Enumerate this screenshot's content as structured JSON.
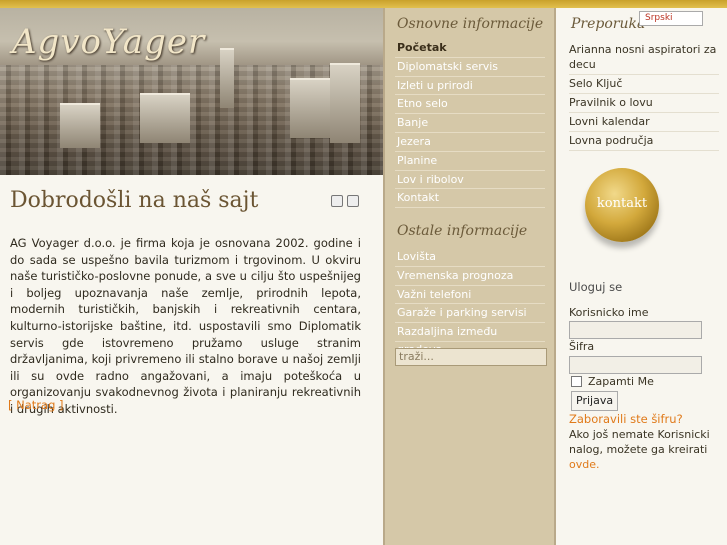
{
  "header": {
    "logo_text": "AgvoYager"
  },
  "main": {
    "title": "Dobrodošli na naš sajt",
    "intro": "AG Voyager d.o.o. je firma koja je osnovana 2002. godine i do sada se uspešno bavila turizmom i trgovinom. U okviru naše turističko-poslovne ponude, a sve u cilju što uspešnijeg i boljeg  upoznavanja naše zemlje, prirodnih lepota, modernih turističkih, banjskih i rekreativnih centara, kulturno-istorijske baštine, itd. uspostavili smo Diplomatik servis gde istovremeno pružamo usluge stranim državljanima, koji privremeno ili stalno borave u našoj zemlji ili su ovde radno angažovani, a imaju poteškoća u organizovanju svakodnevnog života i planiranju rekreativnih i drugih aktivnosti.",
    "back_link": "[ Natrag ]"
  },
  "middle": {
    "title_1": "Osnovne informacije",
    "items_1": [
      "Početak",
      "Diplomatski servis",
      "Izleti u prirodi",
      "Etno selo",
      "Banje",
      "Jezera",
      "Planine",
      "Lov i ribolov",
      "Kontakt"
    ],
    "title_2": "Ostale informacije",
    "items_2": [
      "Lovišta",
      "Vremenska prognoza",
      "Važni telefoni",
      "Garaže i parking servisi",
      "Razdaljina između gradova"
    ],
    "search_placeholder": "traži..."
  },
  "right": {
    "language": "Srpski",
    "pref_title": "Preporuka",
    "pref_items": [
      "Arianna nosni aspiratori za decu",
      "Selo Ključ",
      "Pravilnik o lovu",
      "Lovni kalendar",
      "Lovna područja"
    ],
    "seal_text": "kontakt",
    "login_title": "Uloguj se",
    "username_label": "Korisnicko ime",
    "password_label": "Šifra",
    "remember_label": "Zapamti Me",
    "login_button": "Prijava",
    "forgot_link": "Zaboravili ste šifru?",
    "register_text": "Ako još nemate Korisnicki nalog, možete ga kreirati ",
    "register_link": "ovde."
  },
  "colors": {
    "accent_gold": "#c9a12b",
    "middle_bg": "#d5c8a8",
    "link_orange": "#e07a1a",
    "title_brown": "#6b5533"
  }
}
